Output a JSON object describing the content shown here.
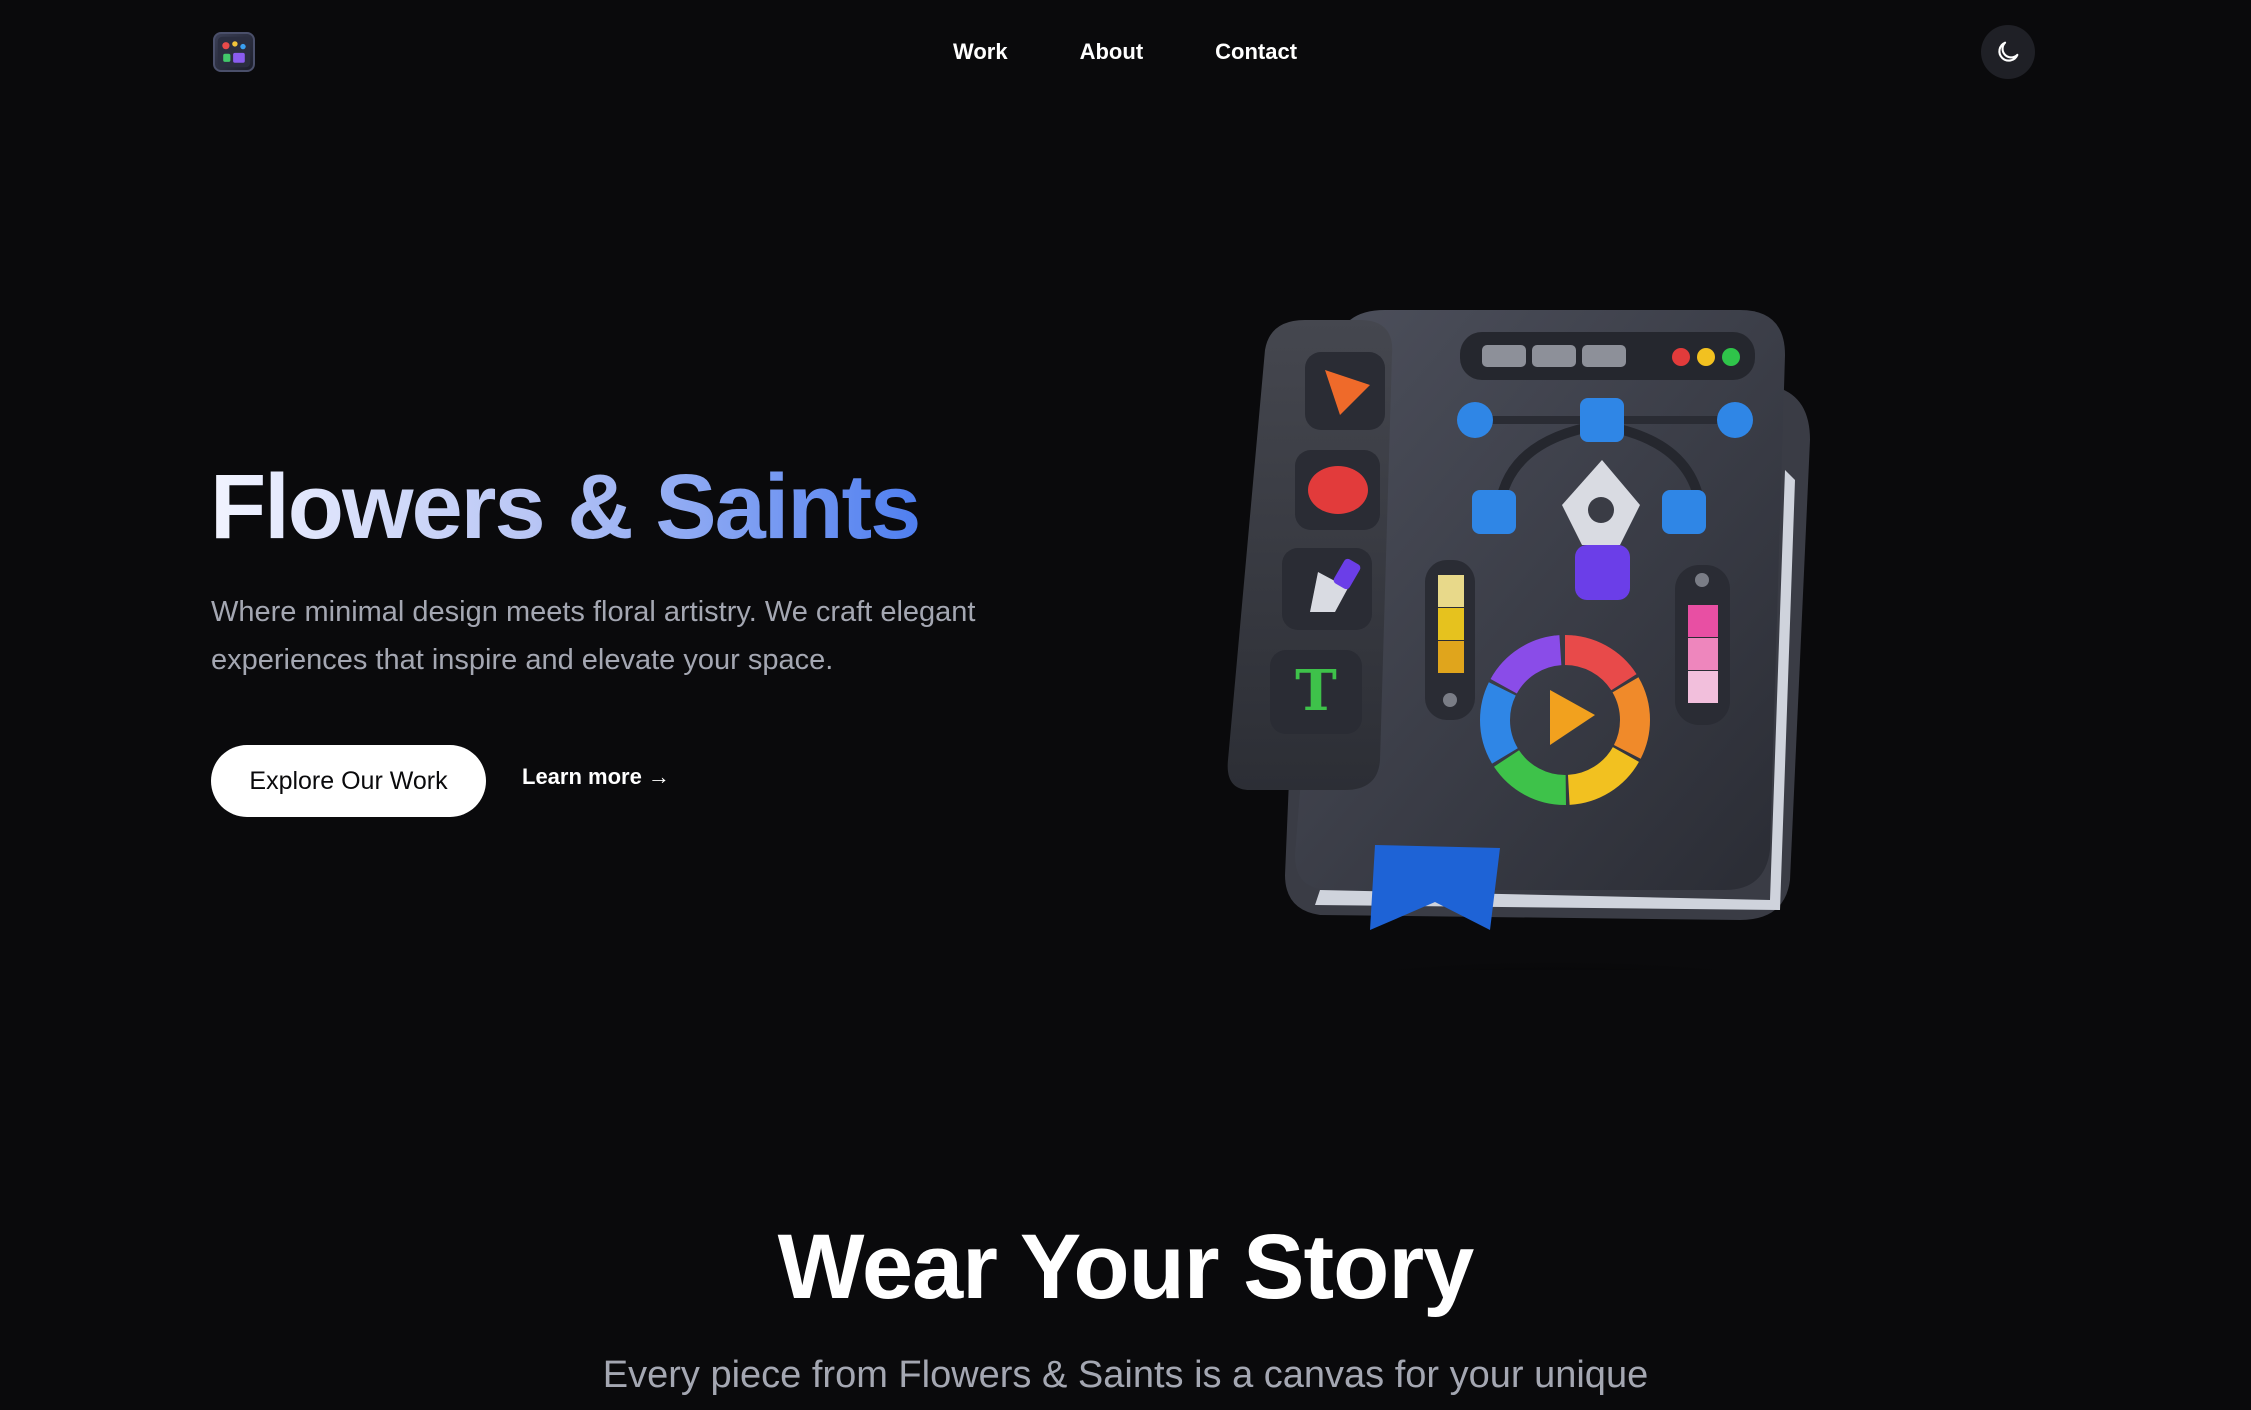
{
  "nav": {
    "logo_icon": "palette-app-logo-icon",
    "links": [
      {
        "label": "Work"
      },
      {
        "label": "About"
      },
      {
        "label": "Contact"
      }
    ],
    "theme_toggle_icon": "moon-icon"
  },
  "hero": {
    "title_part1": "Flowers",
    "title_amp": "&",
    "title_part2": "Saints",
    "subtitle": "Where minimal design meets floral artistry. We craft elegant experiences that inspire and elevate your space.",
    "primary_button": "Explore Our Work",
    "secondary_link": "Learn more →",
    "illustration_icon": "design-toolkit-book-illustration"
  },
  "section": {
    "title": "Wear Your Story",
    "subtitle": "Every piece from Flowers & Saints is a canvas for your unique"
  },
  "colors": {
    "background": "#0a0a0c",
    "accent": "#4f7ff0",
    "text_muted": "#a4a7b2"
  }
}
